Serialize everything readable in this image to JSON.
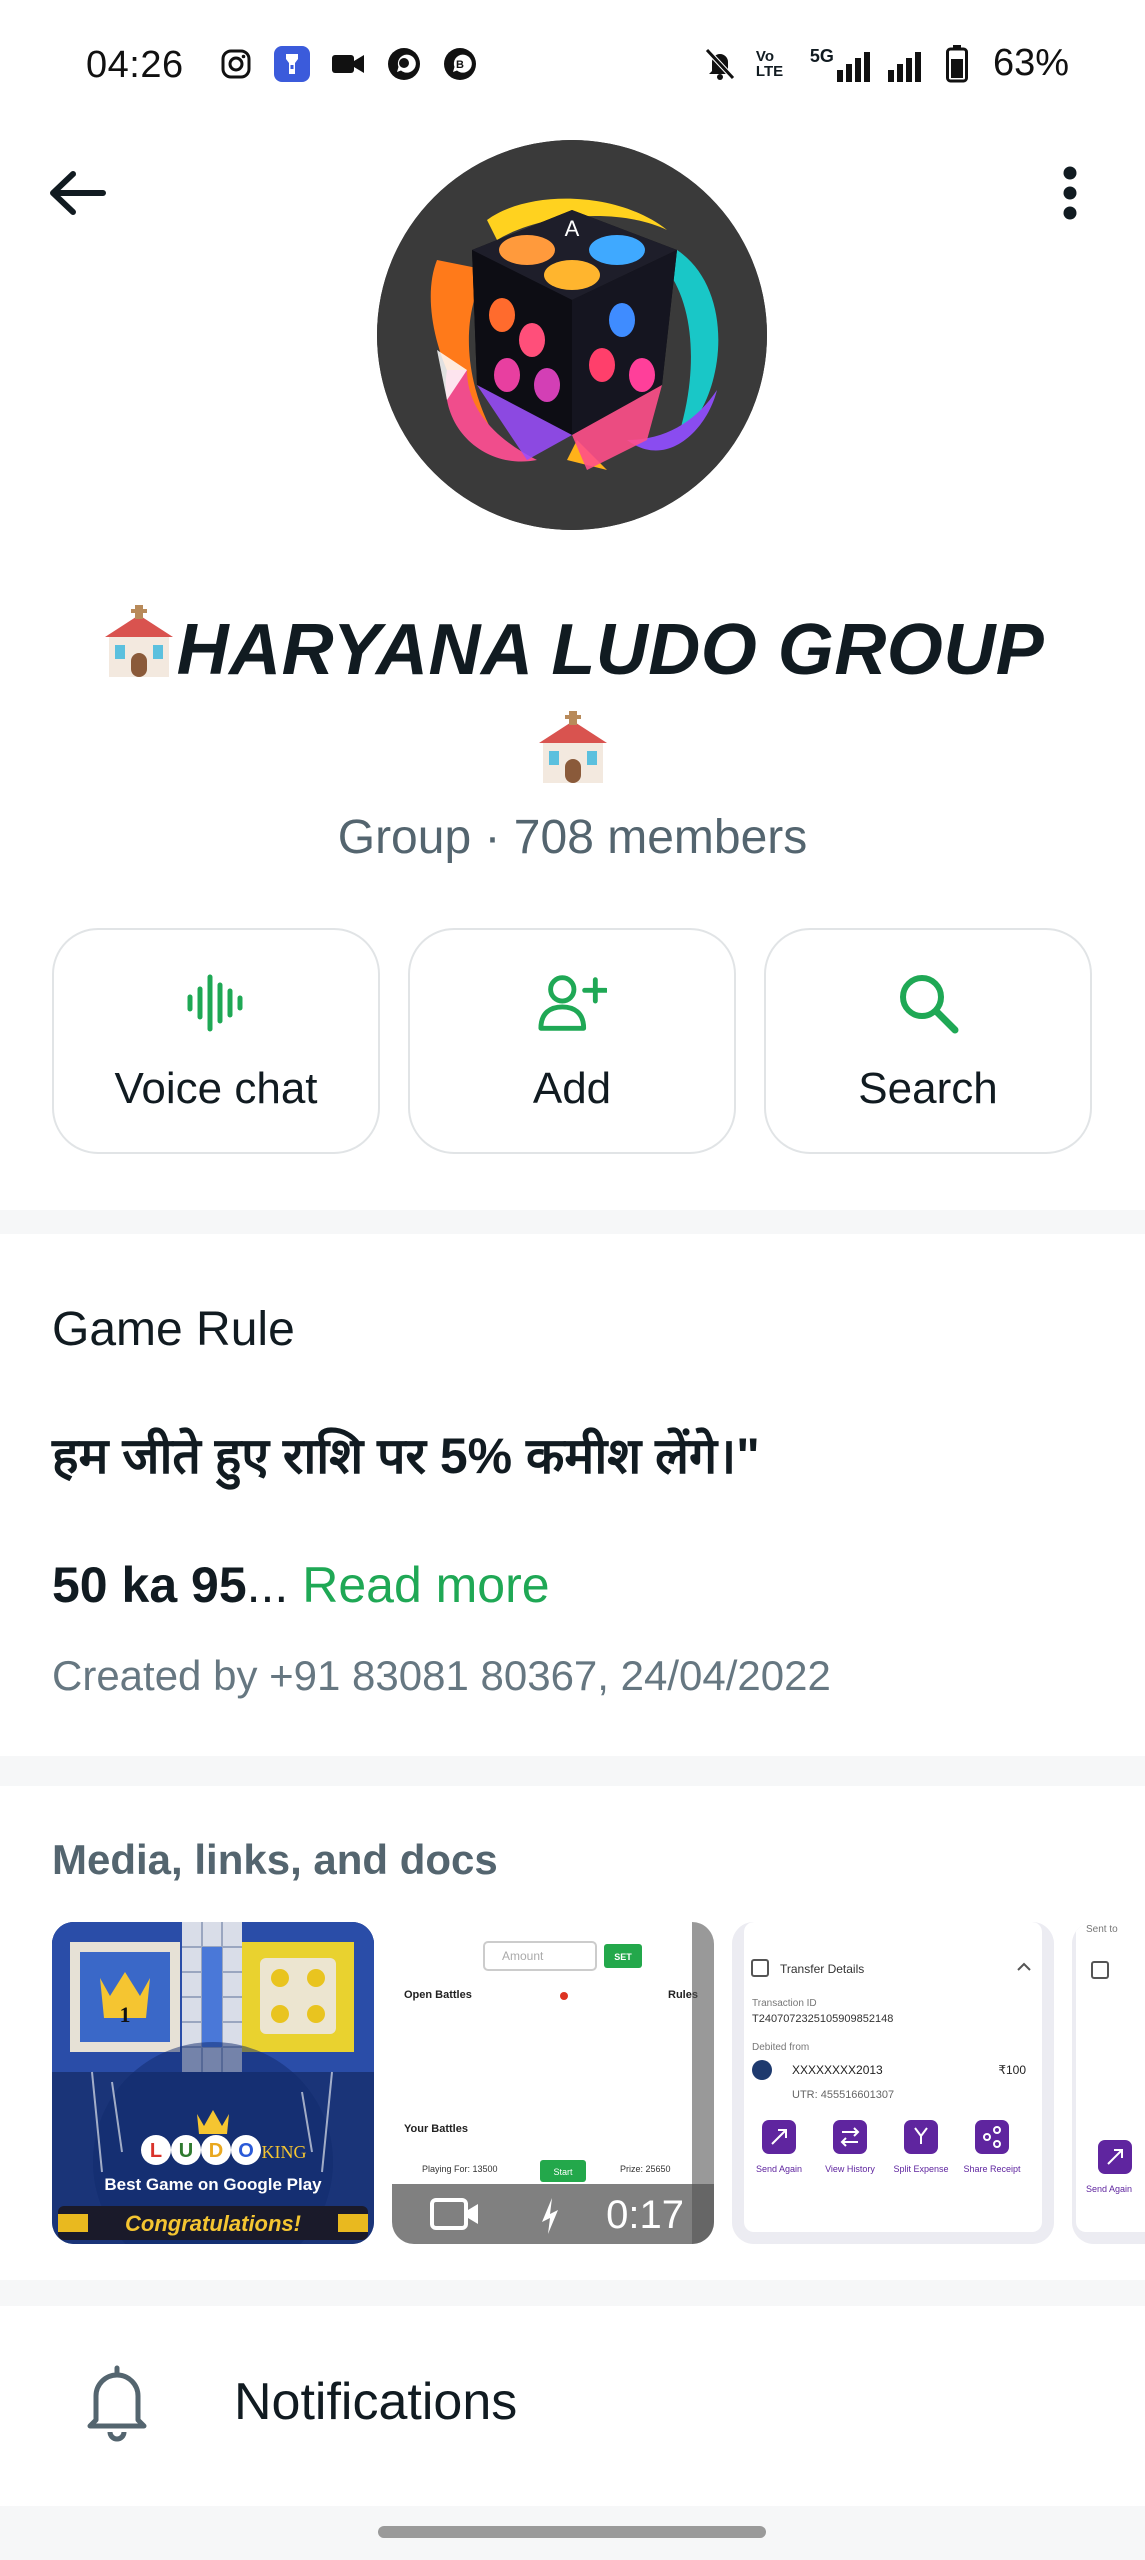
{
  "status_bar": {
    "time": "04:26",
    "network": "5G",
    "volte": "Vo LTE",
    "battery": "63%",
    "icons": [
      "instagram-icon",
      "flashlight-icon",
      "video-camera-icon",
      "whatsapp-icon",
      "whatsapp-business-icon",
      "bell-muted-icon",
      "signal-icon",
      "battery-icon"
    ]
  },
  "header": {
    "back_icon": "arrow-left-icon",
    "menu_icon": "more-vertical-icon"
  },
  "profile": {
    "name_emoji": "⛪",
    "name": "HARYANA LUDO GROUP",
    "subtitle": "Group · 708 members"
  },
  "actions": [
    {
      "label": "Voice chat",
      "icon": "voice-wave-icon"
    },
    {
      "label": "Add",
      "icon": "add-person-icon"
    },
    {
      "label": "Search",
      "icon": "search-icon"
    }
  ],
  "description": {
    "title": "Game Rule",
    "hindi_line": "हम जीते हुए राशि पर 5% कमीश लेंगे।\"",
    "line2_bold": "50 ka 95",
    "line2_ellipsis": "...",
    "read_more": "Read more",
    "created": "Created by +91 83081 80367, 24/04/2022"
  },
  "media": {
    "title": "Media, links, and docs",
    "thumbs": {
      "ludo": {
        "brand": "LUDO KING",
        "tagline": "Best Game on Google Play",
        "banner": "Congratulations!"
      },
      "video": {
        "amount_placeholder": "Amount",
        "set_label": "SET",
        "open_battles": "Open Battles",
        "rules": "Rules",
        "your_battles": "Your Battles",
        "playing_for": "Playing For: 13500",
        "start_label": "Start",
        "prize": "Prize: 25650",
        "duration": "0:17"
      },
      "receipt": {
        "heading": "Transfer Details",
        "txn_label": "Transaction ID",
        "txn_id": "T2407072325105909852148",
        "debited_label": "Debited from",
        "account": "XXXXXXXX2013",
        "amount": "₹100",
        "utr": "UTR: 455516601307",
        "actions": [
          "Send Again",
          "View History",
          "Split Expense",
          "Share Receipt"
        ]
      },
      "partial": {
        "sent_to": "Sent to",
        "send_again": "Send Again"
      }
    }
  },
  "notifications": {
    "label": "Notifications",
    "icon": "bell-icon"
  },
  "colors": {
    "accent_green": "#1fa855",
    "text_primary": "#111b21",
    "text_secondary": "#667781",
    "phonepe_purple": "#5f259f"
  }
}
